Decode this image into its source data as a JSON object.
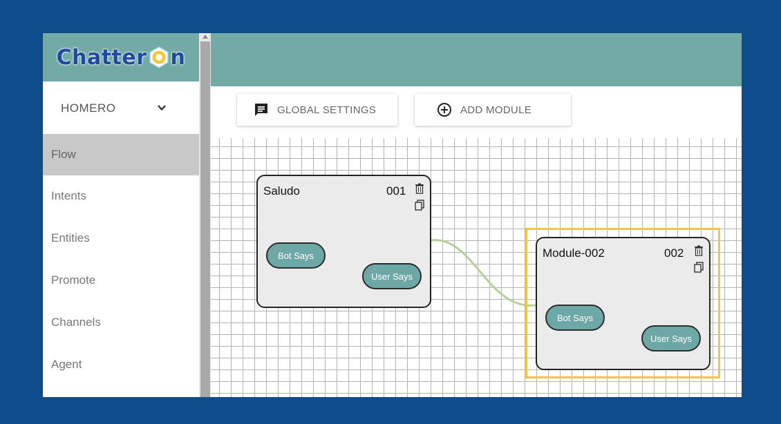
{
  "app": {
    "logo_text_left": "Chatter",
    "logo_text_right": "n"
  },
  "sidebar": {
    "project": "HOMERO",
    "items": [
      {
        "label": "Flow",
        "active": true
      },
      {
        "label": "Intents"
      },
      {
        "label": "Entities"
      },
      {
        "label": "Promote"
      },
      {
        "label": "Channels"
      },
      {
        "label": "Agent"
      }
    ]
  },
  "toolbar": {
    "global_settings_label": "GLOBAL SETTINGS",
    "add_module_label": "ADD MODULE"
  },
  "modules": [
    {
      "title": "Saludo",
      "number": "001",
      "bot_says": "Bot Says",
      "user_says": "User Says",
      "selected": false
    },
    {
      "title": "Module-002",
      "number": "002",
      "bot_says": "Bot Says",
      "user_says": "User Says",
      "selected": true
    }
  ],
  "colors": {
    "background": "#0f4c8c",
    "header": "#73aaa5",
    "pill": "#6ea8a6",
    "selection": "#f5c63a",
    "connector": "#b5d09c",
    "logo_text": "#1e4aa0",
    "logo_accent": "#f5c63a"
  },
  "icons": [
    "chevron-down-icon",
    "message-icon",
    "plus-circle-icon",
    "trash-icon",
    "copy-icon"
  ]
}
